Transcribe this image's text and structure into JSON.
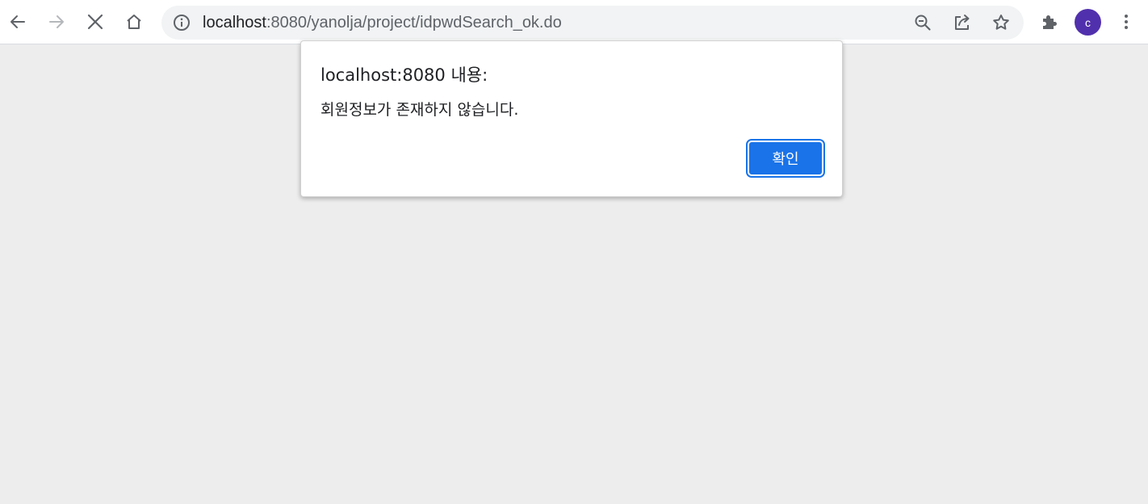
{
  "browser": {
    "url_host": "localhost",
    "url_rest": ":8080/yanolja/project/idpwdSearch_ok.do",
    "profile_initial": "c",
    "profile_color": "#5130ad",
    "icons": {
      "back": "back-arrow-icon",
      "forward": "forward-arrow-icon",
      "stop": "stop-loading-icon",
      "home": "home-icon",
      "site_info": "info-icon",
      "zoom": "zoom-out-icon",
      "share": "share-icon",
      "bookmark": "star-icon",
      "extensions": "puzzle-icon",
      "menu": "kebab-menu-icon"
    }
  },
  "dialog": {
    "title": "localhost:8080 내용:",
    "message": "회원정보가 존재하지 않습니다.",
    "ok_label": "확인",
    "accent": "#1a73e8"
  }
}
